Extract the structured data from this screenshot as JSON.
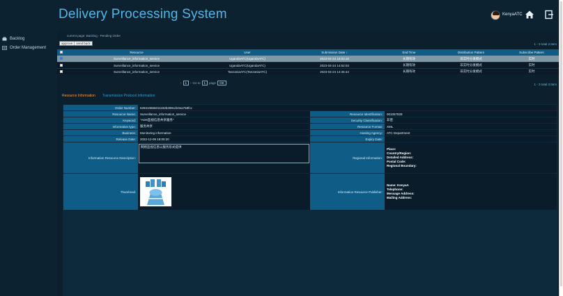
{
  "app": {
    "title": "Delivery Processing System",
    "username": "KenyaATC"
  },
  "sidebar": {
    "items": [
      {
        "label": "Backlog",
        "icon": "briefcase-icon"
      },
      {
        "label": "Order Management",
        "icon": "list-icon"
      }
    ]
  },
  "breadcrumb": "current page: Backlog - Pending Order",
  "actions": {
    "approve": "approve",
    "send_back": "send back"
  },
  "pager": {
    "top": "1 - 3   total 3 Item",
    "bottom": "1 - 3   total 3 Item",
    "go_to": "Go to",
    "page_num": "1",
    "page_label": "page",
    "ok": "OK"
  },
  "table": {
    "headers": [
      "Resource",
      "User",
      "Submission Date ↑",
      "End Time",
      "Distribution Pattern",
      "Subscribe Pattern"
    ],
    "rows": [
      [
        "Surveillance_information_service",
        "UgandaATC(UgandaATC)",
        "2023-04-24 15:03:15",
        "长期有效",
        "非实时分发模式",
        "实时"
      ],
      [
        "Surveillance_information_service",
        "UgandaATC(UgandaATC)",
        "2023-04-24 14:52:03",
        "长期有效",
        "非实时分发模式",
        "实时"
      ],
      [
        "Surveillance_information_service",
        "TanzaniaATC(TanzaniaATC)",
        "2023-04-24 14:45:44",
        "长期有效",
        "非实时分发模式",
        "实时"
      ]
    ]
  },
  "tabs": {
    "active": "Resource Information",
    "other": "Transmission Protocol Information"
  },
  "detail": {
    "left": [
      {
        "label": "Order Number:",
        "value": "628310866011182b289cd10ea758fcc"
      },
      {
        "label": "Resource Name:",
        "value": "Surveillance_information_service"
      },
      {
        "label": "Keyword:",
        "value": "\"ADS监视信息共享服务\""
      },
      {
        "label": "Information type:",
        "value": "服务共享"
      },
      {
        "label": "Business:",
        "value": "Monitoring information"
      },
      {
        "label": "Release Date:",
        "value": "2022-12-09 18:00:20"
      }
    ],
    "right": [
      {
        "label": "Resource Identification:",
        "value": "001057828"
      },
      {
        "label": "Security Classification:",
        "value": "非密"
      },
      {
        "label": "Resource Format:",
        "value": "XML"
      },
      {
        "label": "Hosting Agency:",
        "value": "ATC Department"
      },
      {
        "label": "Expiry Date:",
        "value": ""
      }
    ],
    "description": {
      "label": "Information Resource Description:",
      "value": "网络监视信息以服务形式提供"
    },
    "regional": {
      "label": "Regional Information:",
      "lines": [
        "Place:",
        "Country/Region:",
        "Detailed Address:",
        "Postal Code:",
        "Regional Boundary:"
      ]
    },
    "thumbnail": {
      "label": "Thumbnail:"
    },
    "publisher": {
      "label": "Information Resource Publisher:",
      "lines": [
        "Name:  KenyaA",
        "Telephone:",
        "Message Address:",
        "Mailing Address:"
      ]
    }
  },
  "colors": {
    "accent": "#4fb7e6",
    "header_row": "#0f5d86",
    "selected_row": "#7f98a8",
    "active_tab": "#ff9a3c"
  }
}
